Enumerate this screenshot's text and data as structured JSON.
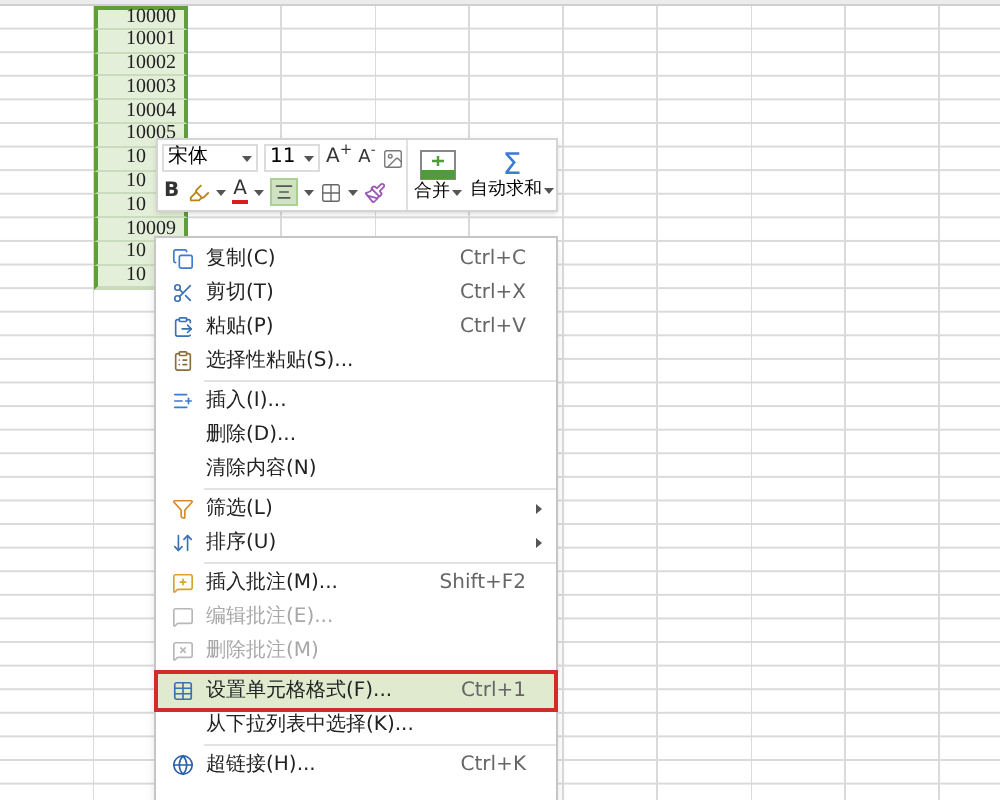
{
  "sheet": {
    "selected_column": [
      {
        "text": "10000"
      },
      {
        "text": "10001"
      },
      {
        "text": "10002"
      },
      {
        "text": "10003"
      },
      {
        "text": "10004"
      },
      {
        "text": "10005"
      },
      {
        "text": "10"
      },
      {
        "text": "10"
      },
      {
        "text": "10"
      },
      {
        "text": "10009"
      },
      {
        "text": "10"
      },
      {
        "text": "10"
      }
    ]
  },
  "mini_toolbar": {
    "font": "宋体",
    "size": "11",
    "grow": "A$^{+}$",
    "shrink": "A$^{-}$",
    "bold": "B",
    "font_color": "A",
    "align_selected": true,
    "merge": "合并",
    "sum_symbol": "Σ",
    "autosum": "自动求和"
  },
  "context_menu": {
    "items": [
      {
        "kind": "item",
        "label": "复制(C)",
        "shortcut": "Ctrl+C",
        "disabled": false,
        "selected": false,
        "submenu": false
      },
      {
        "kind": "item",
        "label": "剪切(T)",
        "shortcut": "Ctrl+X",
        "disabled": false,
        "selected": false,
        "submenu": false
      },
      {
        "kind": "item",
        "label": "粘贴(P)",
        "shortcut": "Ctrl+V",
        "disabled": false,
        "selected": false,
        "submenu": false
      },
      {
        "kind": "item",
        "label": "选择性粘贴(S)...",
        "disabled": false,
        "selected": false,
        "submenu": false
      },
      {
        "kind": "separator"
      },
      {
        "kind": "item",
        "label": "插入(I)...",
        "disabled": false,
        "selected": false,
        "submenu": false
      },
      {
        "kind": "item",
        "label": "删除(D)...",
        "disabled": false,
        "selected": false,
        "submenu": false
      },
      {
        "kind": "item",
        "label": "清除内容(N)",
        "disabled": false,
        "selected": false,
        "submenu": false
      },
      {
        "kind": "separator"
      },
      {
        "kind": "item",
        "label": "筛选(L)",
        "disabled": false,
        "selected": false,
        "submenu": true
      },
      {
        "kind": "item",
        "label": "排序(U)",
        "disabled": false,
        "selected": false,
        "submenu": true
      },
      {
        "kind": "separator"
      },
      {
        "kind": "item",
        "label": "插入批注(M)...",
        "shortcut": "Shift+F2",
        "disabled": false,
        "selected": false,
        "submenu": false
      },
      {
        "kind": "item",
        "label": "编辑批注(E)...",
        "disabled": true,
        "selected": false,
        "submenu": false
      },
      {
        "kind": "item",
        "label": "删除批注(M)",
        "disabled": true,
        "selected": false,
        "submenu": false
      },
      {
        "kind": "separator"
      },
      {
        "kind": "item",
        "label": "设置单元格格式(F)...",
        "shortcut": "Ctrl+1",
        "disabled": false,
        "selected": true,
        "submenu": false
      },
      {
        "kind": "item",
        "label": "从下拉列表中选择(K)...",
        "disabled": false,
        "selected": false,
        "submenu": false
      },
      {
        "kind": "separator"
      },
      {
        "kind": "item",
        "label": "超链接(H)...",
        "shortcut": "Ctrl+K",
        "disabled": false,
        "selected": false,
        "submenu": false
      }
    ]
  }
}
